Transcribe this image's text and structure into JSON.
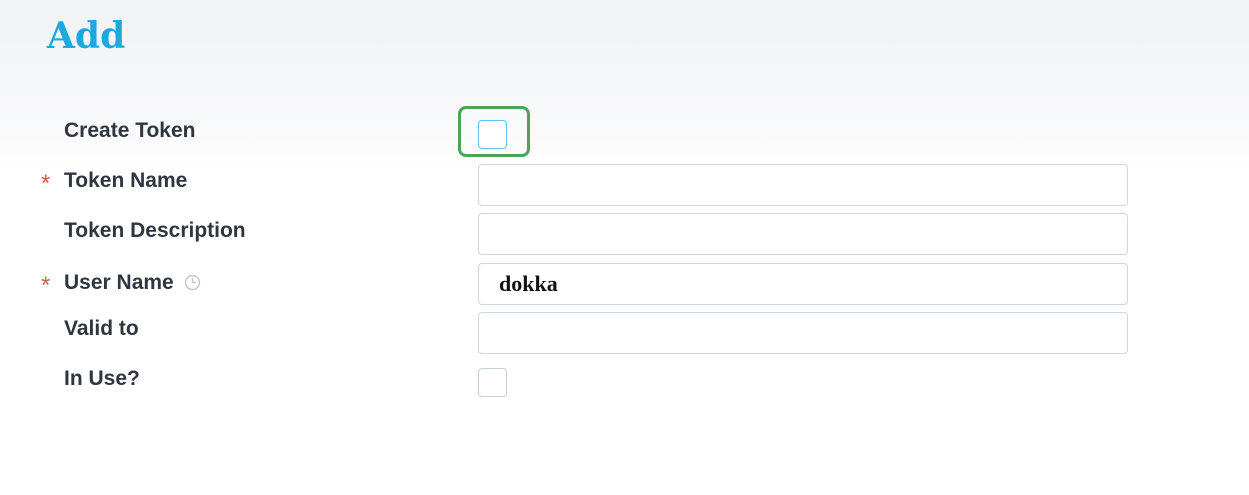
{
  "page": {
    "title": "Add"
  },
  "form": {
    "required_marker": "*",
    "create_token": {
      "label": "Create Token",
      "checked": false,
      "focused": true
    },
    "token_name": {
      "label": "Token Name",
      "required": true,
      "value": ""
    },
    "token_description": {
      "label": "Token Description",
      "value": ""
    },
    "user_name": {
      "label": "User Name",
      "required": true,
      "value": "dokka",
      "info_icon": "clock-info-icon"
    },
    "valid_to": {
      "label": "Valid to",
      "value": ""
    },
    "in_use": {
      "label": "In Use?",
      "checked": false
    }
  },
  "colors": {
    "title": "#1ea8e0",
    "required": "#d35f46",
    "focus_ring": "#4ca35a",
    "focused_checkbox_border": "#5fc1ee"
  }
}
